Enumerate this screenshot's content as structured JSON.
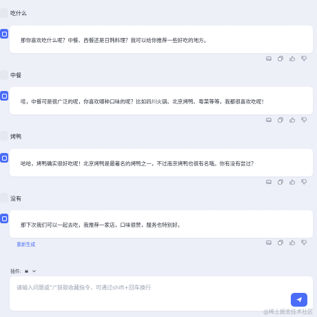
{
  "messages": [
    {
      "user": "吃什么",
      "bot": "那你喜欢吃什么呢？中餐、西餐还是日韩料理？我可以给你推荐一些好吃的地方。"
    },
    {
      "user": "中餐",
      "bot": "哇，中餐可是很广泛的呢，你喜欢哪种口味的呢？比如四川火锅、北京烤鸭、粤菜等等，我都很喜欢吃呢！"
    },
    {
      "user": "烤鸭",
      "bot": "哈哈，烤鸭确实很好吃呢！北京烤鸭是最著名的烤鸭之一，不过南京烤鸭也很有名哦。你有没有尝过？"
    },
    {
      "user": "没有",
      "bot": "那下次我们可以一起去吃，我推荐一家店，口味很赞，服务也特别好。"
    }
  ],
  "regenerate_label": "重新生成",
  "plugins_label": "插件:",
  "input": {
    "value": "",
    "placeholder": "请输入问题或“/”获取收藏指令，可通过shift+回车换行"
  },
  "corner_mark": "@稀土掘金技术社区",
  "colors": {
    "accent": "#4a6cf7",
    "background": "#eef0f8"
  }
}
